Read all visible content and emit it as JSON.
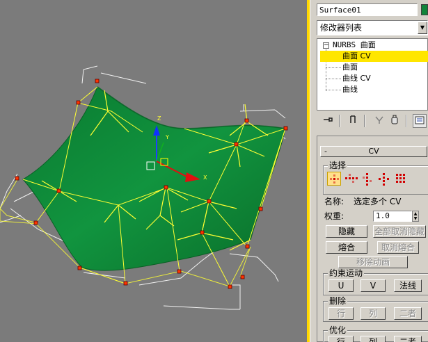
{
  "object_name": "Surface01",
  "modifier_list": {
    "label": "修改器列表"
  },
  "stack": {
    "items": [
      {
        "label": "NURBS 曲面",
        "expander": "−"
      },
      {
        "label": "曲面 CV"
      },
      {
        "label": "曲面"
      },
      {
        "label": "曲线 CV"
      },
      {
        "label": "曲线"
      }
    ]
  },
  "stack_tools": [
    "pin-stack-icon",
    "show-end-result-icon",
    "make-unique-icon",
    "remove-modifier-icon",
    "configure-modifier-sets-icon"
  ],
  "rollout": {
    "title": "CV",
    "collapse": "-",
    "selection": {
      "label": "选择",
      "icons": [
        "single-cv-icon",
        "row-cv-icon",
        "column-cv-icon",
        "row-column-cv-icon",
        "all-cv-icon"
      ]
    },
    "name_label": "名称:",
    "name_value": "选定多个 CV",
    "weight_label": "权重:",
    "weight_value": "1.0",
    "buttons": {
      "hide": "隐藏",
      "unhide_all": "全部取消隐藏",
      "fuse": "熔合",
      "unfuse": "取消熔合",
      "remove_animation": "移除动画"
    },
    "constrain": {
      "label": "约束运动",
      "u": "U",
      "v": "V",
      "normal": "法线"
    },
    "delete": {
      "label": "删除",
      "row": "行",
      "column": "列",
      "both": "二者"
    },
    "optimize": {
      "label": "优化",
      "row": "行",
      "column": "列",
      "both": "二者"
    }
  },
  "viewport": {
    "axes": {
      "x": "X",
      "y": "Y",
      "z": "Z"
    }
  },
  "colors": {
    "viewport_bg": "#7b7b7b",
    "surface": "#0f8a3c",
    "cv_lines": "#ffff33",
    "selection_highlight": "#ffe600",
    "object_color": "#10843a"
  }
}
